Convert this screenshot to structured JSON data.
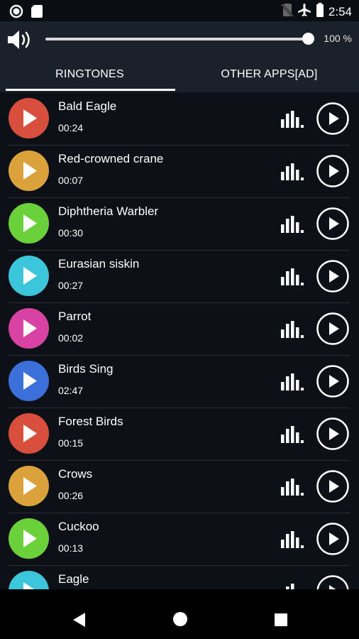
{
  "status_bar": {
    "time": "2:54"
  },
  "volume": {
    "percent_label": "100 %",
    "level": 1.0
  },
  "tabs": [
    {
      "label": "RINGTONES",
      "selected": true
    },
    {
      "label": "OTHER APPS[AD]",
      "selected": false
    }
  ],
  "ringtones": [
    {
      "title": "Bald Eagle",
      "duration": "00:24",
      "color": "#d94f3d"
    },
    {
      "title": "Red-crowned crane",
      "duration": "00:07",
      "color": "#dba23b"
    },
    {
      "title": "Diphtheria Warbler",
      "duration": "00:30",
      "color": "#6bd13b"
    },
    {
      "title": "Eurasian siskin",
      "duration": "00:27",
      "color": "#3cc6db"
    },
    {
      "title": "Parrot",
      "duration": "00:02",
      "color": "#d842a2"
    },
    {
      "title": "Birds Sing",
      "duration": "02:47",
      "color": "#3b6fd9"
    },
    {
      "title": "Forest Birds",
      "duration": "00:15",
      "color": "#d94f3d"
    },
    {
      "title": "Crows",
      "duration": "00:26",
      "color": "#dba23b"
    },
    {
      "title": "Cuckoo",
      "duration": "00:13",
      "color": "#6bd13b"
    },
    {
      "title": "Eagle",
      "duration": "",
      "color": "#3cc6db"
    }
  ],
  "icons": {
    "status_left": [
      "record-icon",
      "sd-card-icon"
    ],
    "status_right": [
      "no-sim-icon",
      "airplane-mode-icon",
      "battery-icon"
    ],
    "volume": "speaker-icon",
    "row": [
      "play-avatar-icon",
      "equalizer-icon",
      "play-circle-icon"
    ],
    "nav": [
      "back-icon",
      "home-icon",
      "recents-icon"
    ]
  }
}
